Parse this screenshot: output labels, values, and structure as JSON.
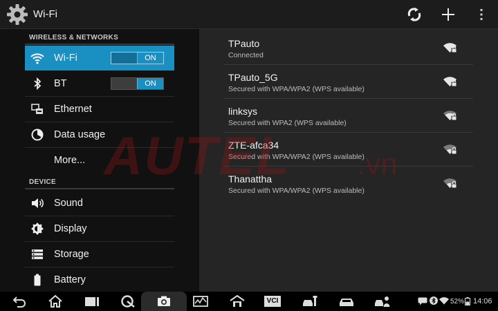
{
  "header": {
    "title": "Wi-Fi",
    "app_icon": "gear-icon",
    "actions": [
      "wps-icon",
      "add-icon",
      "overflow-menu-icon"
    ]
  },
  "sidebar": {
    "sections": [
      {
        "title": "WIRELESS & NETWORKS"
      },
      {
        "title": "DEVICE"
      }
    ],
    "items": [
      {
        "label": "Wi-Fi",
        "icon": "wifi-icon",
        "toggle": "ON",
        "selected": true
      },
      {
        "label": "BT",
        "icon": "bluetooth-icon",
        "toggle": "ON"
      },
      {
        "label": "Ethernet",
        "icon": "ethernet-icon"
      },
      {
        "label": "Data usage",
        "icon": "data-usage-icon"
      },
      {
        "label": "More..."
      },
      {
        "label": "Sound",
        "icon": "speaker-icon"
      },
      {
        "label": "Display",
        "icon": "brightness-icon"
      },
      {
        "label": "Storage",
        "icon": "storage-icon"
      },
      {
        "label": "Battery",
        "icon": "battery-icon"
      }
    ]
  },
  "networks": [
    {
      "ssid": "TPauto",
      "status": "Connected"
    },
    {
      "ssid": "TPauto_5G",
      "status": "Secured with WPA/WPA2 (WPS available)"
    },
    {
      "ssid": "linksys",
      "status": "Secured with WPA2 (WPS available)"
    },
    {
      "ssid": "ZTE-afca34",
      "status": "Secured with WPA/WPA2 (WPS available)"
    },
    {
      "ssid": "Thanattha",
      "status": "Secured with WPA/WPA2 (WPS available)"
    }
  ],
  "watermark": {
    "text": "AUTEL",
    "suffix": ".vn"
  },
  "navbar": {
    "buttons": [
      "back-icon",
      "home-icon",
      "recent-apps-icon",
      "autel-logo-icon",
      "camera-icon",
      "diagnostics-icon",
      "garage-icon",
      "vci-icon",
      "car-service-icon",
      "car-icon",
      "technician-icon"
    ],
    "vci_label": "VCI"
  },
  "statusbar": {
    "battery": "52%",
    "time": "14:06"
  },
  "colors": {
    "accent": "#1a8fc2",
    "pane": "#252525",
    "background": "#111111"
  }
}
